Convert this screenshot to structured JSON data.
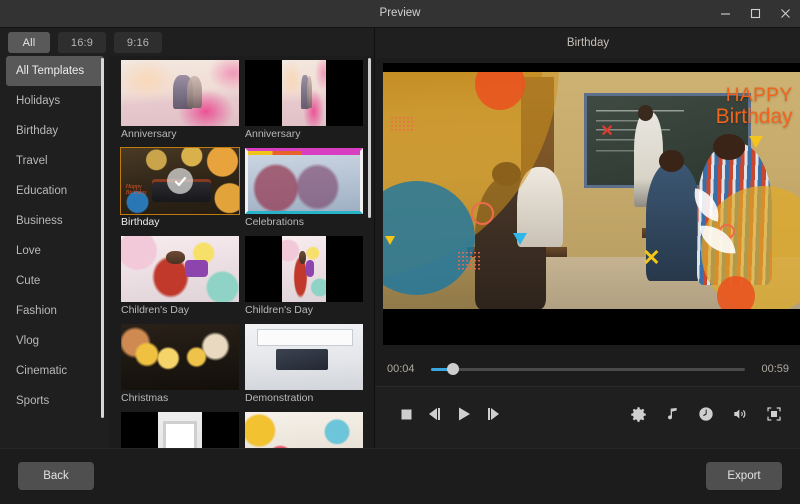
{
  "window": {
    "title": "Preview",
    "minimize_icon": "minimize-icon",
    "maximize_icon": "maximize-icon",
    "close_icon": "close-icon"
  },
  "filters": {
    "tabs": [
      {
        "label": "All",
        "active": true
      },
      {
        "label": "16:9",
        "active": false
      },
      {
        "label": "9:16",
        "active": false
      }
    ]
  },
  "sidebar": {
    "items": [
      {
        "label": "All Templates",
        "active": true
      },
      {
        "label": "Holidays",
        "active": false
      },
      {
        "label": "Birthday",
        "active": false
      },
      {
        "label": "Travel",
        "active": false
      },
      {
        "label": "Education",
        "active": false
      },
      {
        "label": "Business",
        "active": false
      },
      {
        "label": "Love",
        "active": false
      },
      {
        "label": "Cute",
        "active": false
      },
      {
        "label": "Fashion",
        "active": false
      },
      {
        "label": "Vlog",
        "active": false
      },
      {
        "label": "Cinematic",
        "active": false
      },
      {
        "label": "Sports",
        "active": false
      }
    ]
  },
  "templates": [
    {
      "label": "Anniversary",
      "orientation": "landscape",
      "selected": false,
      "art": "art-anniv"
    },
    {
      "label": "Anniversary",
      "orientation": "portrait",
      "selected": false,
      "art": "art-anniv"
    },
    {
      "label": "Birthday",
      "orientation": "landscape",
      "selected": true,
      "art": "art-bday"
    },
    {
      "label": "Celebrations",
      "orientation": "landscape",
      "selected": false,
      "art": "art-celeb"
    },
    {
      "label": "Children's Day",
      "orientation": "landscape",
      "selected": false,
      "art": "art-kids"
    },
    {
      "label": "Children's Day",
      "orientation": "portrait",
      "selected": false,
      "art": "art-kids"
    },
    {
      "label": "Christmas",
      "orientation": "landscape",
      "selected": false,
      "art": "art-xmas"
    },
    {
      "label": "Demonstration",
      "orientation": "landscape",
      "selected": false,
      "art": "art-demo"
    },
    {
      "label": "",
      "orientation": "portrait",
      "selected": false,
      "art": "art-frame"
    },
    {
      "label": "",
      "orientation": "landscape",
      "selected": false,
      "art": "art-party"
    }
  ],
  "preview": {
    "title": "Birthday",
    "overlay_text_line1": "HAPPY",
    "overlay_text_line2": "Birthday",
    "overlay_text_color": "#f0641c",
    "timeline": {
      "current_time": "00:04",
      "total_time": "00:59",
      "progress_percent": 7,
      "fill_color": "#3aa6e0"
    },
    "controls": [
      {
        "name": "stop-button",
        "icon": "stop-icon"
      },
      {
        "name": "previous-frame-button",
        "icon": "previous-frame-icon"
      },
      {
        "name": "play-button",
        "icon": "play-icon"
      },
      {
        "name": "next-frame-button",
        "icon": "next-frame-icon"
      },
      {
        "name": "settings-button",
        "icon": "gear-icon"
      },
      {
        "name": "music-button",
        "icon": "music-note-icon"
      },
      {
        "name": "duration-button",
        "icon": "clock-icon"
      },
      {
        "name": "volume-button",
        "icon": "speaker-icon"
      },
      {
        "name": "fullscreen-button",
        "icon": "fullscreen-icon"
      }
    ]
  },
  "bottom": {
    "back_label": "Back",
    "export_label": "Export"
  },
  "colors": {
    "window_chrome": "#333333",
    "panel_bg": "#1f1f1f",
    "app_bg": "#1c1c1c",
    "selection_highlight": "#585858",
    "template_selected_border": "#c07a10",
    "button_bg": "#4f4f4f",
    "accent_blue": "#3aa6e0"
  }
}
